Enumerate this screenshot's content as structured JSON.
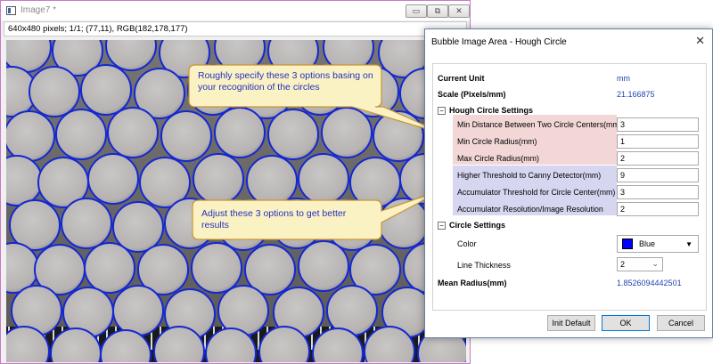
{
  "image_window": {
    "title": "Image7 *",
    "status": "640x480 pixels; 1/1; (77,11), RGB(182,178,177)",
    "circle_color": "#1428d2",
    "buttons": {
      "minimize": "▭",
      "restore": "⧉",
      "close": "✕"
    }
  },
  "dialog": {
    "title": "Bubble Image Area - Hough Circle",
    "close_glyph": "✕",
    "current_unit": {
      "label": "Current Unit",
      "value": "mm"
    },
    "scale": {
      "label": "Scale (Pixels/mm)",
      "value": "21.166875"
    },
    "hough_section": {
      "label": "Hough Circle Settings",
      "fields": [
        {
          "label": "Min Distance Between Two Circle Centers(mm)",
          "value": "3"
        },
        {
          "label": "Min Circle Radius(mm)",
          "value": "1"
        },
        {
          "label": "Max Circle Radius(mm)",
          "value": "2"
        },
        {
          "label": "Higher Threshold to Canny Detector(mm)",
          "value": "9"
        },
        {
          "label": "Accumulator Threshold for Circle Center(mm)",
          "value": "3"
        },
        {
          "label": "Accumulator Resolution/Image Resolution",
          "value": "2"
        }
      ]
    },
    "circle_section": {
      "label": "Circle Settings",
      "color_label": "Color",
      "color_value": "Blue",
      "thickness_label": "Line Thickness",
      "thickness_value": "2"
    },
    "mean_radius": {
      "label": "Mean Radius(mm)",
      "value": "1.8526094442501"
    },
    "buttons": {
      "init_default": "Init Default",
      "ok": "OK",
      "cancel": "Cancel"
    }
  },
  "callouts": {
    "top": "Roughly specify these 3 options basing on your recognition of the circles",
    "bottom": "Adjust these 3 options to get better results"
  },
  "colors": {
    "callout_fill": "#fbf2c4",
    "callout_border": "#c89530",
    "callout_text": "#2230c0",
    "pink_band": "#f3d6d6",
    "lavender_band": "#d6d6f0"
  }
}
